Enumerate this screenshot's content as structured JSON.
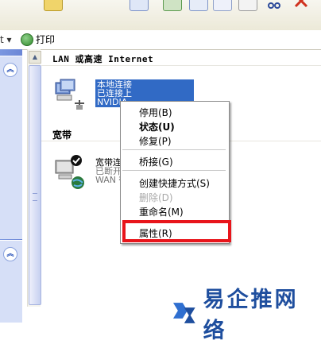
{
  "toolbar": {
    "cut_label": "..."
  },
  "cmdbar": {
    "left_fragment": "t ▾",
    "print_label": "打印"
  },
  "left_pane": {
    "chevron_up": "︽",
    "chevron_up2": "︽"
  },
  "sections": {
    "lan": "LAN 或高速 Internet",
    "broadband": "宽带"
  },
  "lan_connection": {
    "name": "本地连接",
    "status": "已连接上",
    "device": "NVIDIA"
  },
  "broadband_connection": {
    "name": "宽带连",
    "status": "已断开",
    "device": "WAN 微"
  },
  "context_menu": {
    "items": [
      {
        "label": "停用(B)",
        "bold": false,
        "disabled": false
      },
      {
        "label": "状态(U)",
        "bold": true,
        "disabled": false
      },
      {
        "label": "修复(P)",
        "bold": false,
        "disabled": false
      },
      {
        "label": "桥接(G)",
        "bold": false,
        "disabled": false
      },
      {
        "label": "创建快捷方式(S)",
        "bold": false,
        "disabled": false
      },
      {
        "label": "删除(D)",
        "bold": false,
        "disabled": true
      },
      {
        "label": "重命名(M)",
        "bold": false,
        "disabled": false
      },
      {
        "label": "属性(R)",
        "bold": false,
        "disabled": false
      }
    ]
  },
  "watermark": {
    "text": "易企推网络"
  },
  "colors": {
    "selection": "#316ac5",
    "highlight_border": "#e8151b",
    "watermark": "#1e4e9e"
  }
}
